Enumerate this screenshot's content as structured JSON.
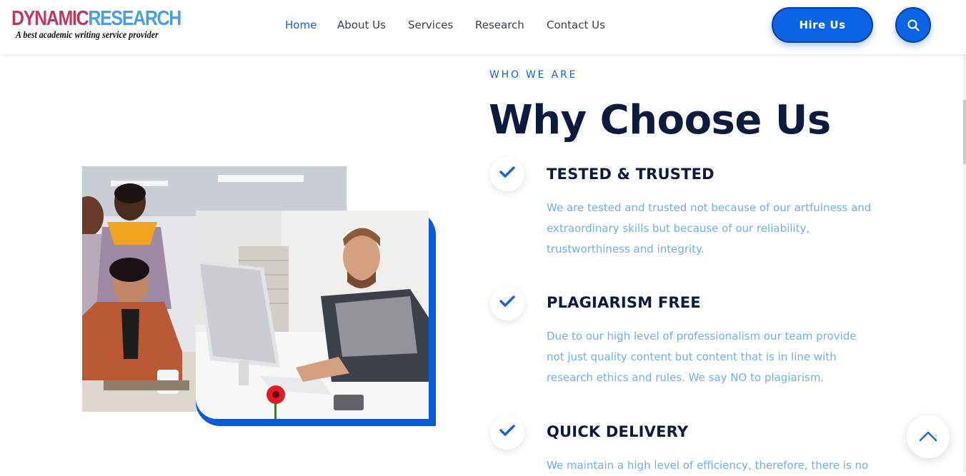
{
  "brand": {
    "logo_part1": "DYNAMIC",
    "logo_part2": "RESEARCH",
    "tagline": "A best academic writing service provider"
  },
  "nav": {
    "items": [
      {
        "label": "Home",
        "active": true
      },
      {
        "label": "About Us",
        "active": false
      },
      {
        "label": "Services",
        "active": false
      },
      {
        "label": "Research",
        "active": false
      },
      {
        "label": "Contact Us",
        "active": false
      }
    ]
  },
  "header": {
    "hire_label": "Hire Us",
    "search_icon": "search-icon"
  },
  "section": {
    "eyebrow": "WHO WE ARE",
    "title": "Why Choose Us",
    "features": [
      {
        "title": "TESTED & TRUSTED",
        "description": "We are tested and trusted not because of our artfulness and extraordinary skills but because of our reliability, trustworthiness and integrity."
      },
      {
        "title": "PLAGIARISM FREE",
        "description": "Due to our high level of professionalism our team provide not just quality content but content that is in line with research ethics and rules. We say NO to plagiarism."
      },
      {
        "title": "QUICK DELIVERY",
        "description": "We maintain a high level of efficiency, therefore, there is no"
      }
    ]
  },
  "colors": {
    "accent": "#1565d8",
    "heading": "#0c1b3d",
    "body_text": "#6fb1ec",
    "logo_red": "#c0395f",
    "logo_blue": "#4b9ee8"
  }
}
